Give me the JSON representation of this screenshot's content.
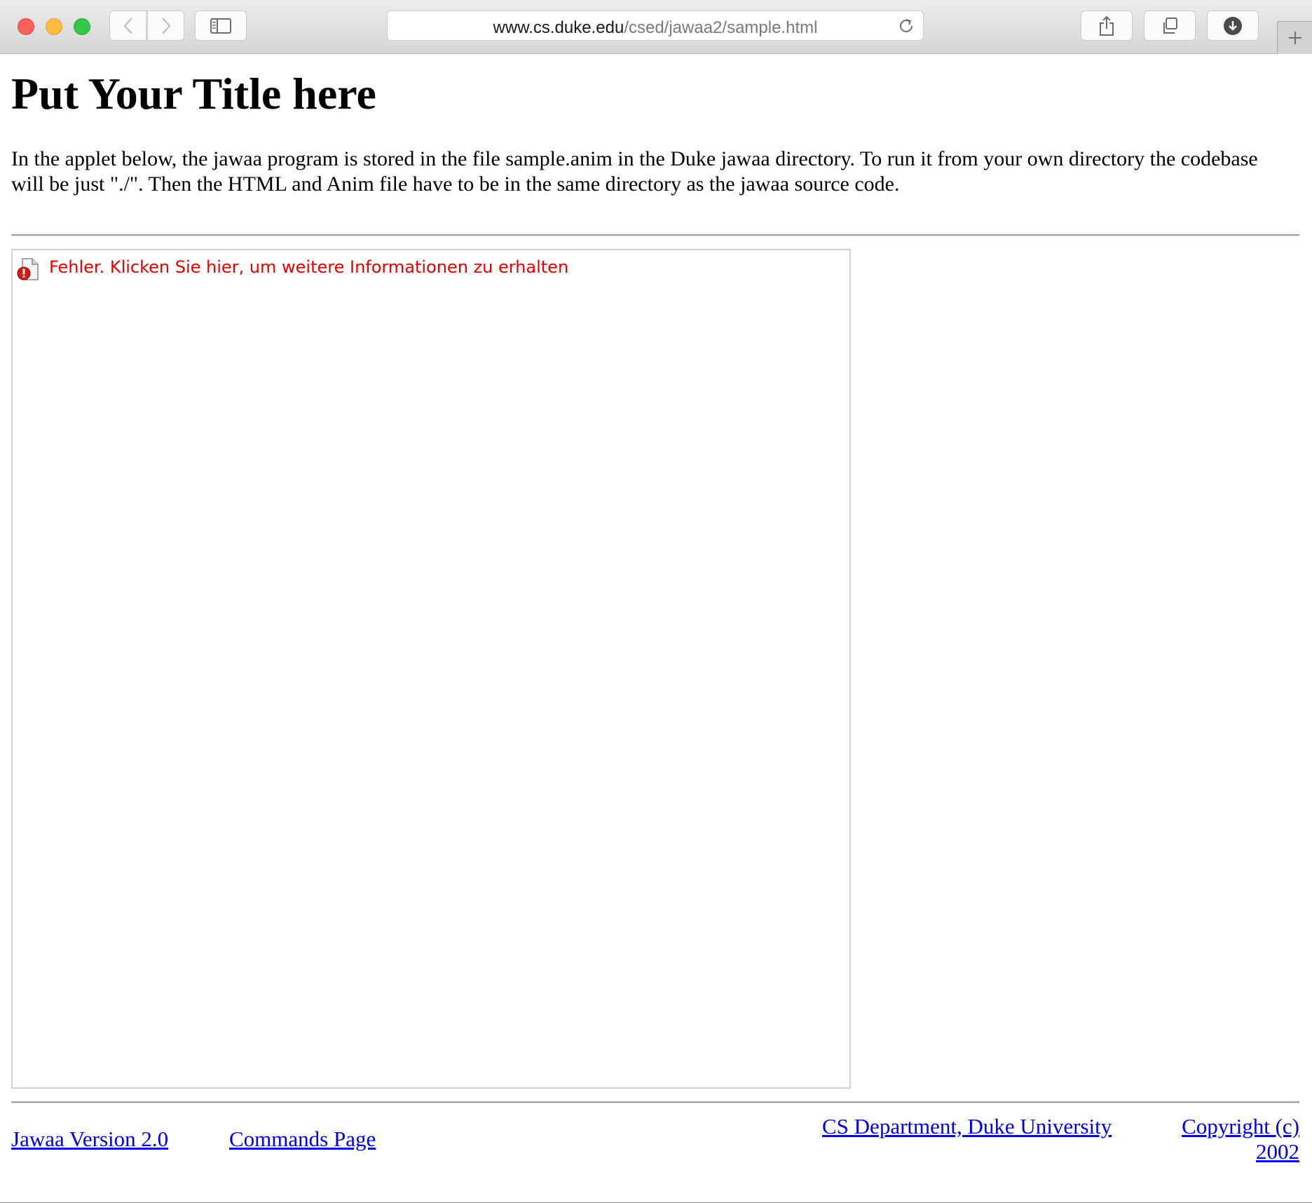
{
  "browser": {
    "url_host": "www.cs.duke.edu",
    "url_path": "/csed/jawaa2/sample.html",
    "icons": {
      "back": "chevron-left-icon",
      "forward": "chevron-right-icon",
      "sidebar": "sidebar-icon",
      "reload": "reload-icon",
      "share": "share-icon",
      "tabs": "tabs-overview-icon",
      "download": "download-icon",
      "new_tab": "plus-icon"
    }
  },
  "page": {
    "title": "Put Your Title here",
    "intro": "In the applet below, the jawaa program is stored in the file sample.anim in the Duke jawaa directory. To run it from your own directory the codebase will be just \"./\". Then the HTML and Anim file have to be in the same directory as the jawaa source code.",
    "applet": {
      "error_text": "Fehler. Klicken Sie hier, um weitere Informationen zu erhalten",
      "error_color": "#e80000"
    },
    "footer": {
      "version_link": "Jawaa Version 2.0",
      "commands_link": "Commands Page",
      "dept_link": "CS Department, Duke University",
      "copyright_line1": "Copyright (c)",
      "copyright_line2": "2002"
    },
    "link_color": "#0000ee"
  }
}
